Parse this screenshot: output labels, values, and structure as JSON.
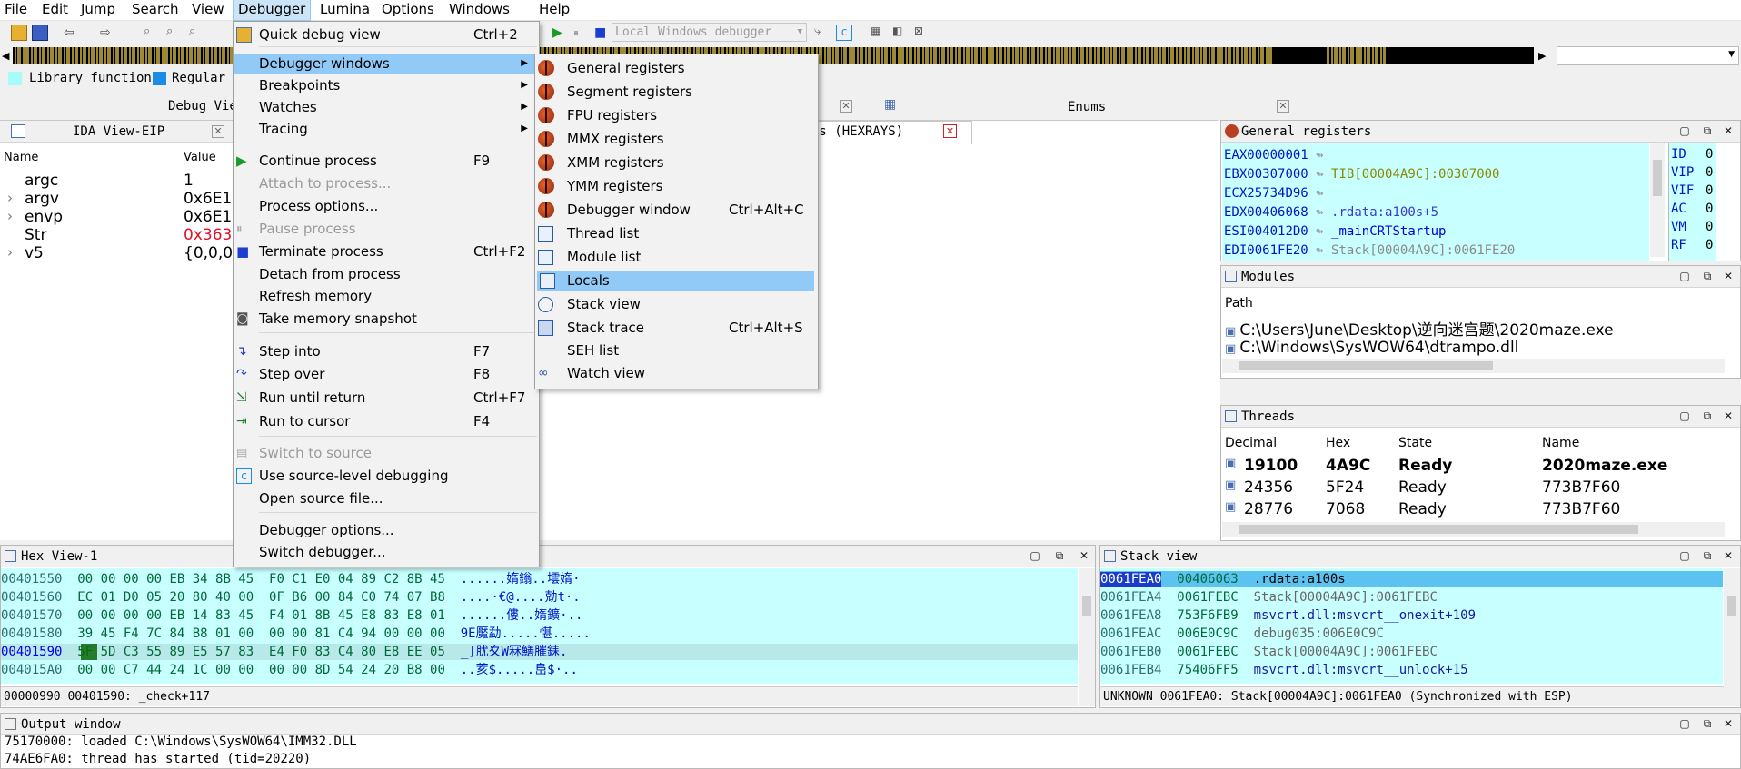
{
  "menubar": [
    "File",
    "Edit",
    "Jump",
    "Search",
    "View",
    "Debugger",
    "Lumina",
    "Options",
    "Windows",
    "Help"
  ],
  "toolbar": {
    "debugger_select": "Local Windows debugger"
  },
  "legend": {
    "library": "Library function",
    "regular": "Regular",
    "library_color": "#a7fbfb",
    "regular_color": "#1a8ce8"
  },
  "tabs": {
    "debug_view": "Debug Vie",
    "locals": "ls (HEXRAYS)",
    "enums": "Enums"
  },
  "ida_view": {
    "title": "IDA View-EIP",
    "headers": [
      "Name",
      "Value"
    ],
    "rows": [
      {
        "name": "argc",
        "value": "1",
        "expand": ""
      },
      {
        "name": "argv",
        "value": "0x6E1",
        "expand": "›"
      },
      {
        "name": "envp",
        "value": "0x6E1",
        "expand": "›"
      },
      {
        "name": "Str",
        "value": "0x363",
        "expand": ""
      },
      {
        "name": "v5",
        "value": "{0,0,0,",
        "expand": "›"
      }
    ]
  },
  "debugger_menu": {
    "items": [
      {
        "label": "Quick debug view",
        "shortcut": "Ctrl+2"
      },
      {
        "label": "Debugger windows",
        "arrow": true
      },
      {
        "label": "Breakpoints",
        "arrow": true
      },
      {
        "label": "Watches",
        "arrow": true
      },
      {
        "label": "Tracing",
        "arrow": true
      },
      {
        "label": "Continue process",
        "shortcut": "F9"
      },
      {
        "label": "Attach to process..."
      },
      {
        "label": "Process options..."
      },
      {
        "label": "Pause process"
      },
      {
        "label": "Terminate process",
        "shortcut": "Ctrl+F2"
      },
      {
        "label": "Detach from process"
      },
      {
        "label": "Refresh memory"
      },
      {
        "label": "Take memory snapshot"
      },
      {
        "label": "Step into",
        "shortcut": "F7"
      },
      {
        "label": "Step over",
        "shortcut": "F8"
      },
      {
        "label": "Run until return",
        "shortcut": "Ctrl+F7"
      },
      {
        "label": "Run to cursor",
        "shortcut": "F4"
      },
      {
        "label": "Switch to source"
      },
      {
        "label": "Use source-level debugging"
      },
      {
        "label": "Open source file..."
      },
      {
        "label": "Debugger options..."
      },
      {
        "label": "Switch debugger..."
      }
    ]
  },
  "windows_submenu": {
    "items": [
      {
        "label": "General registers"
      },
      {
        "label": "Segment registers"
      },
      {
        "label": "FPU registers"
      },
      {
        "label": "MMX registers"
      },
      {
        "label": "XMM registers"
      },
      {
        "label": "YMM registers"
      },
      {
        "label": "Debugger window",
        "shortcut": "Ctrl+Alt+C"
      },
      {
        "label": "Thread list"
      },
      {
        "label": "Module list"
      },
      {
        "label": "Locals"
      },
      {
        "label": "Stack view"
      },
      {
        "label": "Stack trace",
        "shortcut": "Ctrl+Alt+S"
      },
      {
        "label": "SEH list"
      },
      {
        "label": "Watch view"
      }
    ]
  },
  "registers": {
    "title": "General registers",
    "rows": [
      {
        "reg": "EAX",
        "val": "00000001",
        "ref": ""
      },
      {
        "reg": "EBX",
        "val": "00307000",
        "ref": "TIB[00004A9C]:00307000"
      },
      {
        "reg": "ECX",
        "val": "25734D96",
        "ref": ""
      },
      {
        "reg": "EDX",
        "val": "00406068",
        "ref": ".rdata:a100s+5"
      },
      {
        "reg": "ESI",
        "val": "004012D0",
        "ref": "_mainCRTStartup"
      },
      {
        "reg": "EDI",
        "val": "0061FE20",
        "ref": "Stack[00004A9C]:0061FE20"
      }
    ],
    "flags": [
      {
        "name": "ID",
        "val": "0"
      },
      {
        "name": "VIP",
        "val": "0"
      },
      {
        "name": "VIF",
        "val": "0"
      },
      {
        "name": "AC",
        "val": "0"
      },
      {
        "name": "VM",
        "val": "0"
      },
      {
        "name": "RF",
        "val": "0"
      }
    ]
  },
  "modules": {
    "title": "Modules",
    "header": "Path",
    "rows": [
      "C:\\Users\\June\\Desktop\\逆向迷宫题\\2020maze.exe",
      "C:\\Windows\\SysWOW64\\dtrampo.dll"
    ]
  },
  "threads": {
    "title": "Threads",
    "headers": [
      "Decimal",
      "Hex",
      "State",
      "Name"
    ],
    "rows": [
      {
        "dec": "19100",
        "hex": "4A9C",
        "state": "Ready",
        "name": "2020maze.exe"
      },
      {
        "dec": "24356",
        "hex": "5F24",
        "state": "Ready",
        "name": "773B7F60"
      },
      {
        "dec": "28776",
        "hex": "7068",
        "state": "Ready",
        "name": "773B7F60"
      }
    ]
  },
  "hexview": {
    "title": "Hex View-1",
    "rows": [
      {
        "addr": "00401550",
        "bytes": "00 00 00 00 EB 34 8B 45  F0 C1 E0 04 89 C2 8B 45",
        "ascii": "......媠鎓..墵媠·"
      },
      {
        "addr": "00401560",
        "bytes": "EC 01 D0 05 20 80 40 00  0F B6 00 84 C0 74 07 B8",
        "ascii": "....·€@....勀t·."
      },
      {
        "addr": "00401570",
        "bytes": "00 00 00 00 EB 14 83 45  F4 01 8B 45 E8 83 E8 01",
        "ascii": "......僂..媠鑛·.."
      },
      {
        "addr": "00401580",
        "bytes": "39 45 F4 7C 84 B8 01 00  00 00 81 C4 94 00 00 00",
        "ascii": "9E魘勐.....愖....."
      },
      {
        "addr": "00401590",
        "bytes": "5F 5D C3 55 89 E5 57 83  E4 F0 83 C4 80 E8 EE 05",
        "ascii": "_]肬夊W冧鱔膗銇."
      },
      {
        "addr": "004015A0",
        "bytes": "00 00 C7 44 24 1C 00 00  00 00 8D 54 24 20 B8 00",
        "ascii": "..荄$.....峊$·.."
      }
    ],
    "status": "00000990 00401590: _check+117"
  },
  "stackview": {
    "title": "Stack view",
    "rows": [
      {
        "addr": "0061FEA0",
        "val": "00406063",
        "ref": ".rdata:a100s"
      },
      {
        "addr": "0061FEA4",
        "val": "0061FEBC",
        "ref": "Stack[00004A9C]:0061FEBC"
      },
      {
        "addr": "0061FEA8",
        "val": "753F6FB9",
        "ref": "msvcrt.dll:msvcrt__onexit+109"
      },
      {
        "addr": "0061FEAC",
        "val": "006E0C9C",
        "ref": "debug035:006E0C9C"
      },
      {
        "addr": "0061FEB0",
        "val": "0061FEBC",
        "ref": "Stack[00004A9C]:0061FEBC"
      },
      {
        "addr": "0061FEB4",
        "val": "75406FF5",
        "ref": "msvcrt.dll:msvcrt__unlock+15"
      }
    ],
    "status": "UNKNOWN 0061FEA0: Stack[00004A9C]:0061FEA0 (Synchronized with ESP)"
  },
  "output": {
    "title": "Output window",
    "lines": [
      "75170000: loaded C:\\Windows\\SysWOW64\\IMM32.DLL",
      "74AE6FA0: thread has started (tid=20220)"
    ]
  }
}
